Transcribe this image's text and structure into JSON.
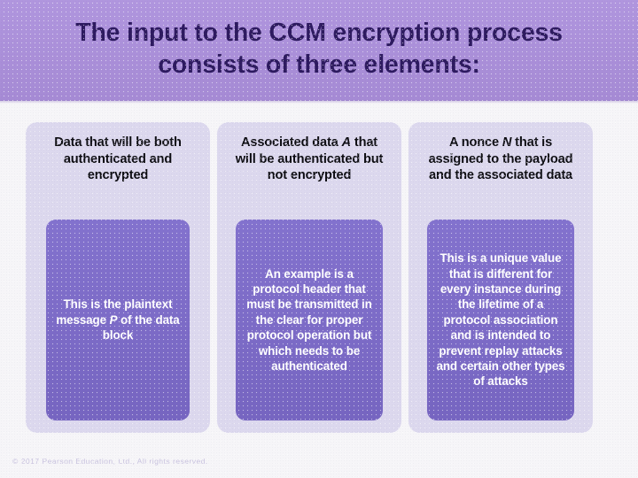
{
  "slide": {
    "title": "The input to the CCM encryption process consists of three elements:",
    "footer": "© 2017 Pearson Education, Ltd., All rights reserved.",
    "colors": {
      "banner": "#ab8fdc",
      "title_text": "#2d1a5f",
      "card_light": "#dcd8ee",
      "card_purple": "#7c6acb",
      "body_text": "#ffffff",
      "header_text": "#0d0d12",
      "background": "#f6f5f8",
      "footer_text": "#c9c3df"
    },
    "columns": [
      {
        "header": "Data that will be both authenticated and encrypted",
        "header_html": "Data that will be both authenticated and encrypted",
        "body": "This is the plaintext message P of the data block",
        "body_html": "This is the plaintext message <i class=\"var\">P</i> of the data block"
      },
      {
        "header": "Associated data A that will be authenticated but not encrypted",
        "header_html": "Associated data <i class=\"var\">A</i> that will be authenticated but not encrypted",
        "body": "An example is a protocol header that must be transmitted in the clear for proper protocol operation but which needs to be authenticated",
        "body_html": "An example is a protocol header that must be transmitted in the clear for proper protocol operation but which needs to be authenticated"
      },
      {
        "header": "A nonce N that is assigned to the payload and the associated data",
        "header_html": "A nonce <i class=\"var\">N</i> that is assigned to the payload and the associated data",
        "body": "This is a unique value that is different for every instance during the lifetime of a protocol association and is intended to prevent replay attacks and certain other types of attacks",
        "body_html": "This is a unique value that is different for every instance during the lifetime of a protocol association and is intended to prevent replay attacks and certain other types of attacks"
      }
    ]
  }
}
